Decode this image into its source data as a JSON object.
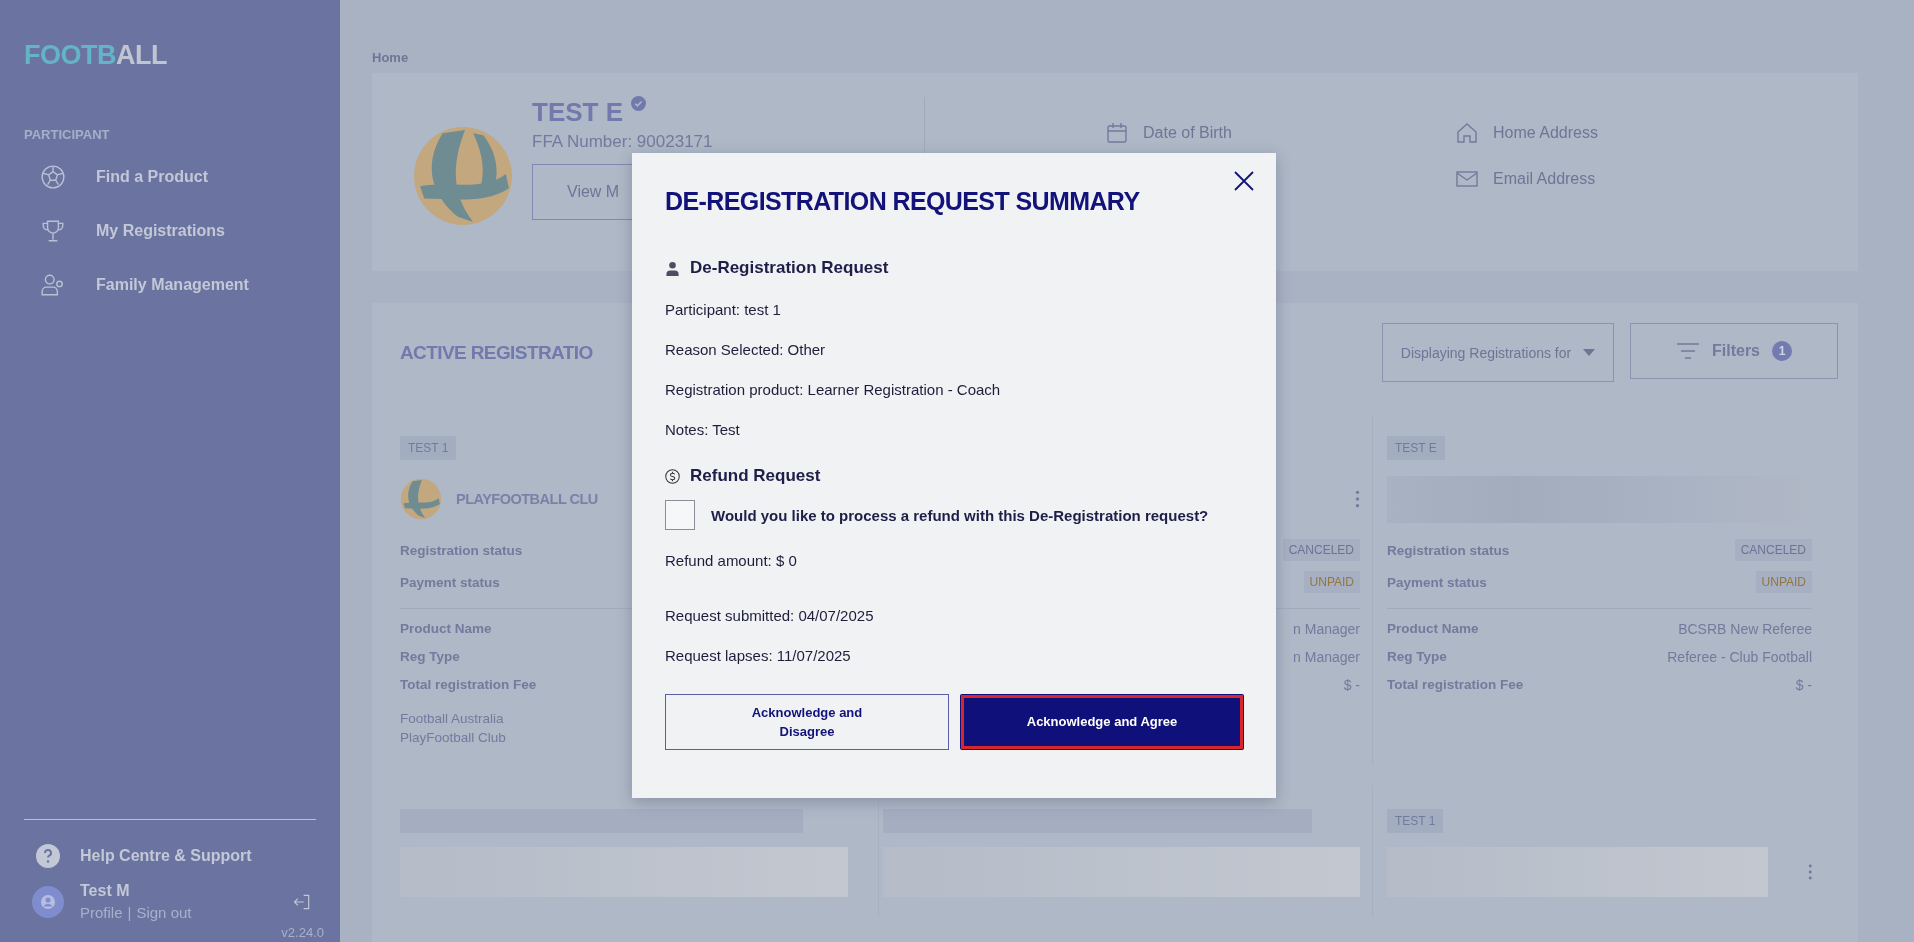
{
  "sidebar": {
    "logo_parts": [
      {
        "text": "FOOTB",
        "accent": true
      },
      {
        "text": "ALL",
        "accent": false
      }
    ],
    "section": "PARTICIPANT",
    "items": [
      {
        "label": "Find a Product"
      },
      {
        "label": "My Registrations"
      },
      {
        "label": "Family Management"
      }
    ],
    "help": "Help Centre & Support",
    "user": {
      "name": "Test M",
      "links": [
        "Profile",
        "Sign out"
      ],
      "separator": "|"
    },
    "version": "v2.24.0"
  },
  "breadcrumb": "Home",
  "profile": {
    "name": "TEST E",
    "verified": true,
    "ffa_number": "FFA Number: 90023171",
    "button": "View M",
    "details": [
      {
        "label": "Date of Birth"
      },
      {
        "label": "Home Address"
      },
      {
        "label": "Email Address"
      }
    ]
  },
  "registrations": {
    "title": "ACTIVE REGISTRATIO",
    "dropdown": "Displaying Registrations for",
    "filters": {
      "label": "Filters",
      "count": "1"
    },
    "cards": [
      {
        "kind": "club",
        "tag": "TEST 1",
        "club": "PLAYFOOTBALL CLU",
        "status": [
          {
            "label": "Registration status"
          },
          {
            "label": "Payment status"
          }
        ],
        "details": [
          {
            "label": "Product Name"
          },
          {
            "label": "Reg Type"
          },
          {
            "label": "Total registration Fee"
          }
        ],
        "notes": [
          "Football Australia",
          "PlayFootball Club"
        ]
      },
      {
        "kind": "covered",
        "menu": true,
        "status": [
          {
            "value": "CANCELED",
            "color": "#6c7396"
          },
          {
            "value": "UNPAID",
            "color": "#94773e"
          }
        ],
        "details": [
          {
            "value": "n Manager"
          },
          {
            "value": "n Manager"
          },
          {
            "value": "$ -"
          }
        ]
      },
      {
        "kind": "redacted",
        "tag": "TEST E",
        "status": [
          {
            "label": "Registration status",
            "value": "CANCELED",
            "color": "#6c7396"
          },
          {
            "label": "Payment status",
            "value": "UNPAID",
            "color": "#94773e"
          }
        ],
        "details": [
          {
            "label": "Product Name",
            "value": "BCSRB New Referee"
          },
          {
            "label": "Reg Type",
            "value": "Referee - Club Football"
          },
          {
            "label": "Total registration Fee",
            "value": "$ -"
          }
        ]
      }
    ],
    "bottom_cards": [
      {
        "kind": "redacted"
      },
      {
        "kind": "redacted"
      },
      {
        "kind": "tagged",
        "tag": "TEST 1",
        "menu": true
      }
    ]
  },
  "modal": {
    "title": "DE-REGISTRATION REQUEST SUMMARY",
    "sections": [
      {
        "heading": "De-Registration Request",
        "lines": [
          "Participant: test 1",
          "Reason Selected: Other",
          "Registration product: Learner Registration - Coach",
          "Notes: Test"
        ]
      },
      {
        "heading": "Refund Request",
        "checkbox": {
          "label": "Would you like to process a refund with this De-Registration request?",
          "checked": false
        },
        "lines": [
          "Refund amount: $ 0"
        ]
      }
    ],
    "dates": [
      "Request submitted: 04/07/2025",
      "Request lapses: 11/07/2025"
    ],
    "buttons": [
      {
        "label": "Acknowledge and Disagree",
        "kind": "outline",
        "focused": false
      },
      {
        "label": "Acknowledge and Agree",
        "kind": "primary",
        "focused": true
      }
    ]
  }
}
